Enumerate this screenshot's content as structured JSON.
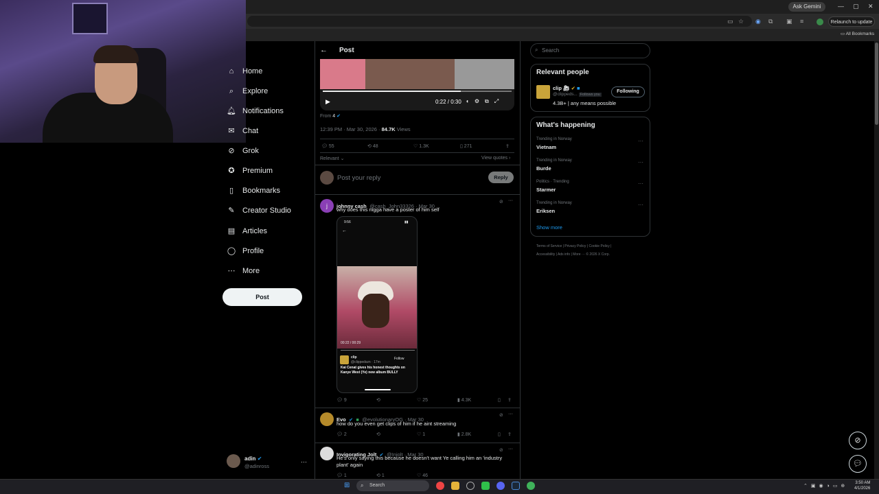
{
  "browser": {
    "ask_gemini": "Ask Gemini",
    "relaunch": "Relaunch to update",
    "all_bookmarks": "All Bookmarks"
  },
  "nav": {
    "items": [
      {
        "label": "Home",
        "icon": "home-icon"
      },
      {
        "label": "Explore",
        "icon": "search-icon"
      },
      {
        "label": "Notifications",
        "icon": "bell-icon"
      },
      {
        "label": "Chat",
        "icon": "chat-icon"
      },
      {
        "label": "Grok",
        "icon": "grok-icon"
      },
      {
        "label": "Premium",
        "icon": "premium-icon"
      },
      {
        "label": "Bookmarks",
        "icon": "bookmark-icon"
      },
      {
        "label": "Creator Studio",
        "icon": "creator-icon"
      },
      {
        "label": "Articles",
        "icon": "articles-icon"
      },
      {
        "label": "Profile",
        "icon": "profile-icon"
      },
      {
        "label": "More",
        "icon": "more-icon"
      }
    ],
    "post_button": "Post",
    "account": {
      "name": "adin",
      "handle": "@adinross",
      "more": "···"
    }
  },
  "post": {
    "header_title": "Post",
    "video": {
      "time": "0:22 / 0:30",
      "progress": 0.73
    },
    "from_label": "From",
    "time": "12:39 PM · Mar 30, 2026 ·",
    "views_count": "84.7K",
    "views_label": "Views",
    "stats": {
      "replies": "55",
      "reposts": "48",
      "likes": "1.3K",
      "bookmarks": "271"
    },
    "sort_label": "Relevant",
    "view_quotes": "View quotes",
    "reply_placeholder": "Post your reply",
    "reply_button": "Reply"
  },
  "replies": [
    {
      "name": "johnny cash",
      "handle": "@cash_John33326 · Mar 30",
      "text": "why does this nigga have a poster of him self",
      "avatar_letter": "j",
      "avatar_color": "#8a3fb5",
      "stats": {
        "replies": "9",
        "reposts": "",
        "likes": "25",
        "views": "4.3K"
      },
      "embed": {
        "status_time": "9:56",
        "video_time": "00:22 / 00:29",
        "account": "clip",
        "account_handle": "@clippedszn · 17m",
        "follow": "Follow",
        "caption": "Kai Cenat gives his honest thoughts on Kanye West (Ye) new album BULLY"
      }
    },
    {
      "name": "Evo",
      "handle": "@evolutionaryOG · Mar 30",
      "text": "how do you even get clips of him if he aint streaming",
      "avatar_color": "#b58a2a",
      "stats": {
        "replies": "2",
        "reposts": "",
        "likes": "1",
        "views": "2.8K"
      }
    },
    {
      "name": "Invigorating Jolt",
      "handle": "@Injolt · Mar 30",
      "text": "He's only saying this because he doesn't want Ye calling him an 'industry plant' again",
      "avatar_color": "#dddddd",
      "stats": {
        "replies": "1",
        "reposts": "1",
        "likes": "46",
        "views": ""
      }
    }
  ],
  "sidebar": {
    "search_placeholder": "Search",
    "relevant_title": "Relevant people",
    "person": {
      "name": "clip",
      "handle": "@clippeds...",
      "follows_you": "Follows you",
      "bio": "4.3B+ | any means possible",
      "button": "Following"
    },
    "happening_title": "What's happening",
    "trends": [
      {
        "category": "Trending in Norway",
        "name": "Vietnam"
      },
      {
        "category": "Trending in Norway",
        "name": "Burde"
      },
      {
        "category": "Politics · Trending",
        "name": "Starmer"
      },
      {
        "category": "Trending in Norway",
        "name": "Eriksen"
      }
    ],
    "show_more": "Show more",
    "footer1": "Terms of Service  |  Privacy Policy  |  Cookie Policy  |",
    "footer2": "Accessibility  |  Ads info  |  More ···  © 2026 X Corp."
  },
  "taskbar": {
    "search": "Search",
    "time": "3:50 AM",
    "date": "4/1/2026"
  }
}
